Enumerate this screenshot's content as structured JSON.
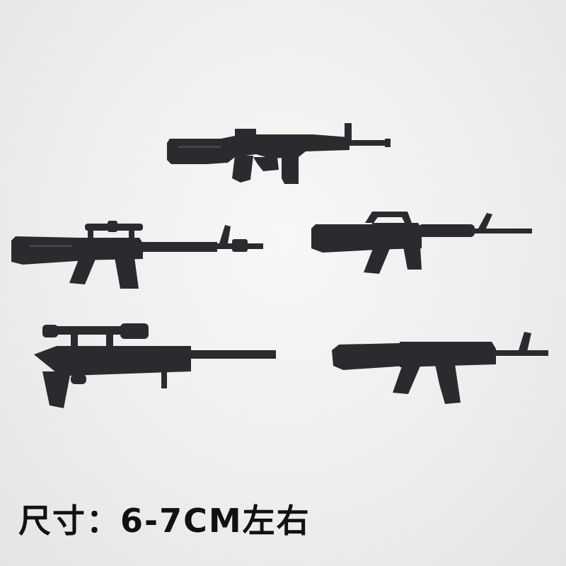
{
  "caption": "尺寸：6-7CM左右",
  "colors": {
    "background": "#eeeeee",
    "toy": "#2a2b2e",
    "caption": "#111111"
  },
  "items": [
    {
      "icon": "rifle-g3-icon"
    },
    {
      "icon": "rifle-m16-scoped-icon"
    },
    {
      "icon": "rifle-m16-icon"
    },
    {
      "icon": "sniper-rifle-icon"
    },
    {
      "icon": "rifle-ak-icon"
    }
  ]
}
